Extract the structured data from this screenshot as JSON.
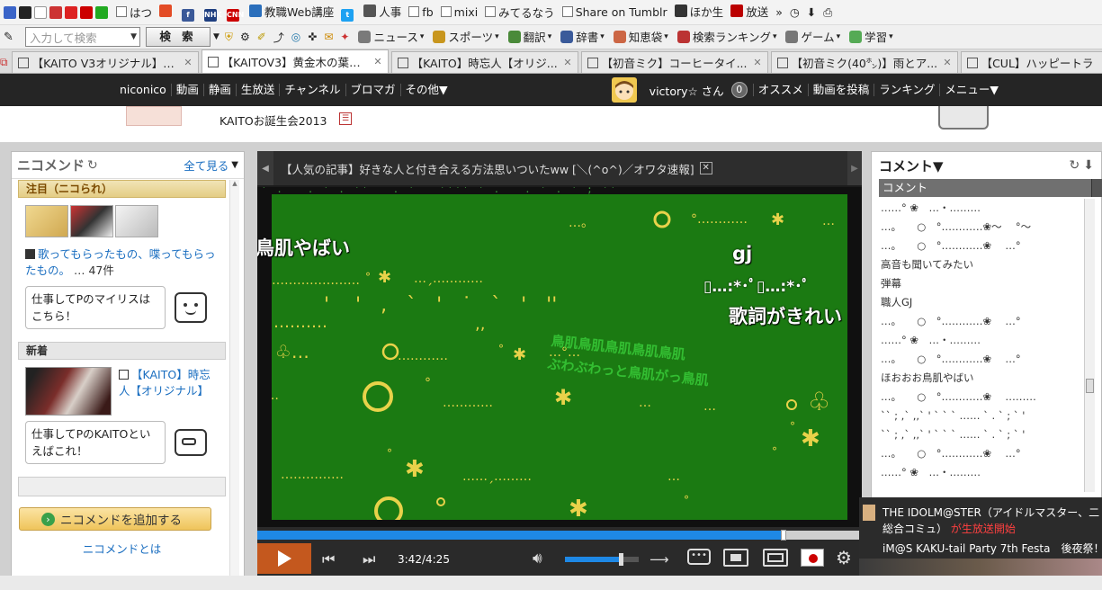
{
  "bookmarks": {
    "items": [
      {
        "label": "はつ",
        "kind": "checkbox"
      },
      {
        "label": "",
        "kind": "icon",
        "color": "#e34c26"
      },
      {
        "label": "",
        "kind": "icon",
        "color": "#3b5998",
        "glyph": "f"
      },
      {
        "label": "",
        "kind": "icon",
        "color": "#1f3f80",
        "glyph": "NHK"
      },
      {
        "label": "",
        "kind": "icon",
        "color": "#cc0000",
        "glyph": "CNN"
      },
      {
        "label": "教職Web講座",
        "kind": "icon",
        "color": "#2a6ebb"
      },
      {
        "label": "",
        "kind": "icon",
        "color": "#1da1f2",
        "glyph": "t"
      },
      {
        "label": "人事",
        "kind": "icon",
        "color": "#555"
      },
      {
        "label": "fb",
        "kind": "checkbox"
      },
      {
        "label": "mixi",
        "kind": "checkbox"
      },
      {
        "label": "みてるなう",
        "kind": "checkbox"
      },
      {
        "label": "Share on Tumblr",
        "kind": "checkbox"
      },
      {
        "label": "ほか生",
        "kind": "icon",
        "color": "#333"
      },
      {
        "label": "放送",
        "kind": "icon",
        "color": "#b00"
      }
    ],
    "more": "»"
  },
  "toolbar": {
    "search_placeholder": "入力して検索",
    "search_button": "検 索",
    "items": [
      "ニュース",
      "スポーツ",
      "翻訳",
      "辞書",
      "知恵袋",
      "検索ランキング",
      "ゲーム",
      "学習"
    ]
  },
  "tabs": [
    {
      "title": "【KAITO V3オリジナル】C...",
      "active": false
    },
    {
      "title": "【KAITOV3】黄金木の葉が...",
      "active": true
    },
    {
      "title": "【KAITO】時忘人【オリジ...",
      "active": false
    },
    {
      "title": "【初音ミク】コーヒータイ...",
      "active": false
    },
    {
      "title": "【初音ミク(40㌿)】雨とア...",
      "active": false
    },
    {
      "title": "【CUL】ハッピートラ",
      "active": false
    }
  ],
  "nav": {
    "left": [
      "niconico",
      "動画",
      "静画",
      "生放送",
      "チャンネル",
      "ブロマガ",
      "その他▼"
    ],
    "user": "victory☆ さん",
    "points": "0",
    "right": [
      "オススメ",
      "動画を投稿",
      "ランキング",
      "メニュー▼"
    ]
  },
  "header": {
    "event": "KAITOお誕生会2013"
  },
  "left_panel": {
    "title": "ニコメンド",
    "see_all": "全て見る",
    "section_attention": "注目（ニコられ）",
    "attention_link": "歌ってもらったもの、喋ってもらったもの。",
    "attention_count": "… 47件",
    "balloon1": "仕事してPのマイリスはこちら！",
    "section_new": "新着",
    "new_link": "【KAITO】時忘人【オリジナル】",
    "balloon2": "仕事してPのKAITOといえばこれ！",
    "add_button": "ニコメンドを追加する",
    "about_link": "ニコメンドとは"
  },
  "player": {
    "marquee": "【人気の記事】好きな人と付き合える方法思いついたww [＼(^o^)／オワタ速報]",
    "overlay_comments": [
      "鳥肌やばい",
      "gj",
      "歌詞がきれい"
    ],
    "time_current": "3:42",
    "time_total": "4:25",
    "progress": 0.871,
    "volume": 0.75
  },
  "right_panel": {
    "title": "コメント▼",
    "column": "コメント",
    "comments": [
      "……° ❀　…・………",
      "…。　　○　°…………❀～　 °～",
      "…。　　○　°…………❀　 …°",
      "高音も聞いてみたい",
      "弾幕",
      "職人GJ",
      "…。　　○　°…………❀　 …°",
      "……° ❀　…・………",
      "…。　　○　°…………❀　 …°",
      "ほおおお鳥肌やばい",
      "…。　　○　°…………❀　 ………",
      "`` ;  ,`  ,,` ' ` ` ` …… ` . ` ; ` ' ",
      "`` ;  ,`  ,,` ' ` ` ` …… ` . ` ; ` ' ",
      "…。　　○　°…………❀　 …°",
      "……° ❀　…・………"
    ]
  },
  "notification": {
    "line1": "THE IDOLM@STER（アイドルマスター、二",
    "line2a": "総合コミュ）",
    "line2b": "が生放送開始",
    "line3": "iM@S KAKU-tail Party 7th Festa　後夜祭！"
  }
}
